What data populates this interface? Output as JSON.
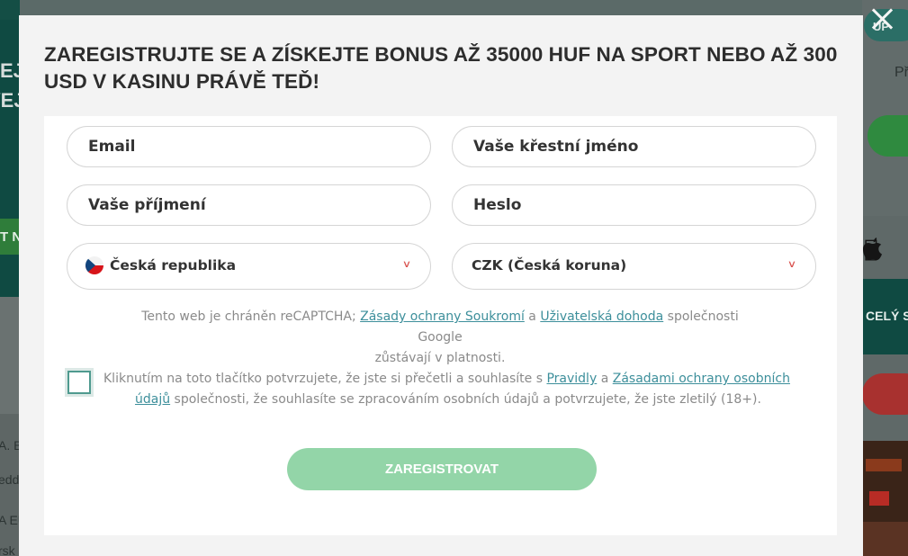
{
  "modal": {
    "title": "ZAREGISTRUJTE SE A ZÍSKEJTE BONUS AŽ 35000 HUF NA SPORT NEBO AŽ 300 USD V KASINU PRÁVĚ TEĎ!",
    "close_icon": "close-icon"
  },
  "form": {
    "email_placeholder": "Email",
    "first_name_placeholder": "Vaše křestní jméno",
    "last_name_placeholder": "Vaše příjmení",
    "password_placeholder": "Heslo",
    "country": {
      "value": "Česká republika",
      "flag_icon": "czech-flag-icon"
    },
    "currency": {
      "value": "CZK (Česká koruna)"
    },
    "chevron_icon": "chevron-down-icon",
    "chevron_color": "#d9534f"
  },
  "recaptcha": {
    "text_before": "Tento web je chráněn reCAPTCHA; ",
    "privacy_link": "Zásady ochrany Soukromí",
    "and": " a ",
    "terms_link": "Uživatelská dohoda",
    "text_after_line1": " společnosti Google",
    "text_line2": "zůstávají v platnosti."
  },
  "consent": {
    "checked": false,
    "text_before": "Kliknutím na toto tlačítko potvrzujete, že jste si přečetli a souhlasíte s ",
    "rules_link": "Pravidly",
    "and": " a ",
    "privacy_link_part1": "Zásadami ochrany osobních",
    "privacy_link_part2": "údajů",
    "text_after": " společnosti, že souhlasíte se zpracováním osobních údajů a potvrzujete, že jste zletilý (18+)."
  },
  "submit": {
    "label": "ZAREGISTROVAT",
    "color": "#93d5a8"
  },
  "background": {
    "left_texts": [
      "EJ",
      "VEJ",
      "T N",
      "A. B",
      "edd",
      "A EU",
      "rsk"
    ],
    "right_texts": [
      "UP",
      "Př",
      "CELÝ S"
    ],
    "accent_green": "#2f8a3f",
    "accent_red": "#a8312f",
    "teal": "#0e5a4d",
    "apple_icon": "apple-icon"
  }
}
